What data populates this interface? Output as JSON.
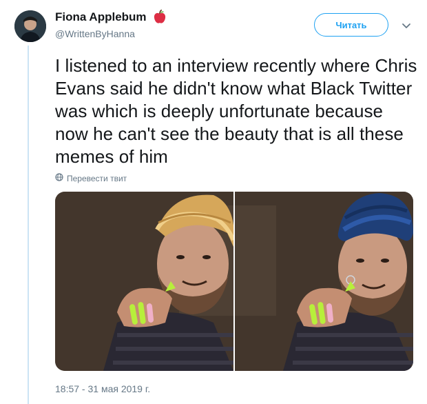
{
  "tweet": {
    "display_name": "Fiona Applebum",
    "handle": "@WrittenByHanna",
    "follow_label": "Читать",
    "text": "I listened to an interview recently where Chris Evans said he didn't know what Black Twitter was which is deeply unfortunate because now he can't see the beauty that is all these memes of him",
    "translate_label": "Перевести твит",
    "timestamp": "18:57 - 31 мая 2019 г."
  },
  "colors": {
    "accent": "#1da1f2",
    "muted": "#657786",
    "text": "#14171a",
    "thread_line": "#cce4f5"
  },
  "icons": [
    "red-apple-icon",
    "chevron-down-icon",
    "globe-icon"
  ]
}
